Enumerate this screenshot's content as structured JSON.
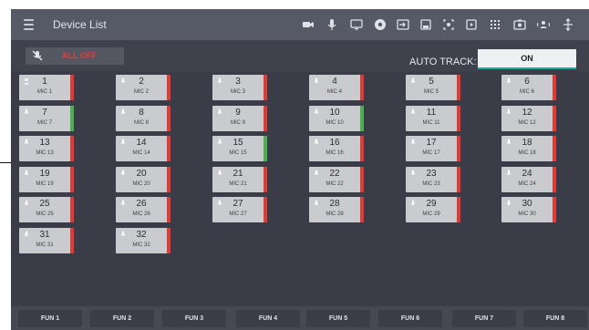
{
  "header": {
    "title": "Device List",
    "icons": [
      "camera-icon",
      "mic-icon",
      "monitor-icon",
      "gear-icon",
      "input-icon",
      "save-icon",
      "target-icon",
      "play-box-icon",
      "grid-icon",
      "camera-box-icon",
      "person-wave-icon",
      "vertical-split-icon"
    ]
  },
  "controls": {
    "all_off_label": "ALL OFF",
    "auto_track_label": "AUTO TRACK:",
    "auto_track_value": "ON"
  },
  "colors": {
    "active": "#4caf50",
    "inactive": "#e53935",
    "accent": "#26a69a"
  },
  "mics": [
    {
      "num": "1",
      "name": "MIC 1",
      "status": "red",
      "icon": "person-icon"
    },
    {
      "num": "2",
      "name": "MIC 2",
      "status": "red",
      "icon": "mic-icon"
    },
    {
      "num": "3",
      "name": "MIC 3",
      "status": "red",
      "icon": "mic-icon"
    },
    {
      "num": "4",
      "name": "MIC 4",
      "status": "red",
      "icon": "mic-icon"
    },
    {
      "num": "5",
      "name": "MIC 5",
      "status": "red",
      "icon": "mic-icon"
    },
    {
      "num": "6",
      "name": "MIC 6",
      "status": "red",
      "icon": "mic-icon"
    },
    {
      "num": "7",
      "name": "MIC 7",
      "status": "green",
      "icon": "mic-icon"
    },
    {
      "num": "8",
      "name": "MIC 8",
      "status": "red",
      "icon": "mic-icon"
    },
    {
      "num": "9",
      "name": "MIC 9",
      "status": "red",
      "icon": "mic-icon"
    },
    {
      "num": "10",
      "name": "MIC 10",
      "status": "green",
      "icon": "mic-icon"
    },
    {
      "num": "11",
      "name": "MIC 11",
      "status": "red",
      "icon": "mic-icon"
    },
    {
      "num": "12",
      "name": "MIC 12",
      "status": "red",
      "icon": "mic-icon"
    },
    {
      "num": "13",
      "name": "MIC 13",
      "status": "red",
      "icon": "mic-icon"
    },
    {
      "num": "14",
      "name": "MIC 14",
      "status": "red",
      "icon": "mic-icon"
    },
    {
      "num": "15",
      "name": "MIC 15",
      "status": "green",
      "icon": "mic-icon"
    },
    {
      "num": "16",
      "name": "MIC 16",
      "status": "red",
      "icon": "mic-icon"
    },
    {
      "num": "17",
      "name": "MIC 17",
      "status": "red",
      "icon": "mic-icon"
    },
    {
      "num": "18",
      "name": "MIC 18",
      "status": "red",
      "icon": "mic-icon"
    },
    {
      "num": "19",
      "name": "MIC 19",
      "status": "red",
      "icon": "mic-icon"
    },
    {
      "num": "20",
      "name": "MIC 20",
      "status": "red",
      "icon": "mic-icon"
    },
    {
      "num": "21",
      "name": "MIC 21",
      "status": "red",
      "icon": "mic-icon"
    },
    {
      "num": "22",
      "name": "MIC 22",
      "status": "red",
      "icon": "mic-icon"
    },
    {
      "num": "23",
      "name": "MIC 23",
      "status": "red",
      "icon": "mic-icon"
    },
    {
      "num": "24",
      "name": "MIC 24",
      "status": "red",
      "icon": "mic-icon"
    },
    {
      "num": "25",
      "name": "MIC 25",
      "status": "red",
      "icon": "mic-icon"
    },
    {
      "num": "26",
      "name": "MIC 26",
      "status": "red",
      "icon": "mic-icon"
    },
    {
      "num": "27",
      "name": "MIC 27",
      "status": "red",
      "icon": "mic-icon"
    },
    {
      "num": "28",
      "name": "MIC 28",
      "status": "red",
      "icon": "mic-icon"
    },
    {
      "num": "29",
      "name": "MIC 29",
      "status": "red",
      "icon": "mic-icon"
    },
    {
      "num": "30",
      "name": "MIC 30",
      "status": "red",
      "icon": "mic-icon"
    },
    {
      "num": "31",
      "name": "MIC 31",
      "status": "red",
      "icon": "mic-icon"
    },
    {
      "num": "32",
      "name": "MIC 32",
      "status": "red",
      "icon": "mic-icon"
    }
  ],
  "fun_buttons": [
    "FUN 1",
    "FUN 2",
    "FUN 3",
    "FUN 4",
    "FUN 5",
    "FUN 6",
    "FUN 7",
    "FUN 8"
  ]
}
